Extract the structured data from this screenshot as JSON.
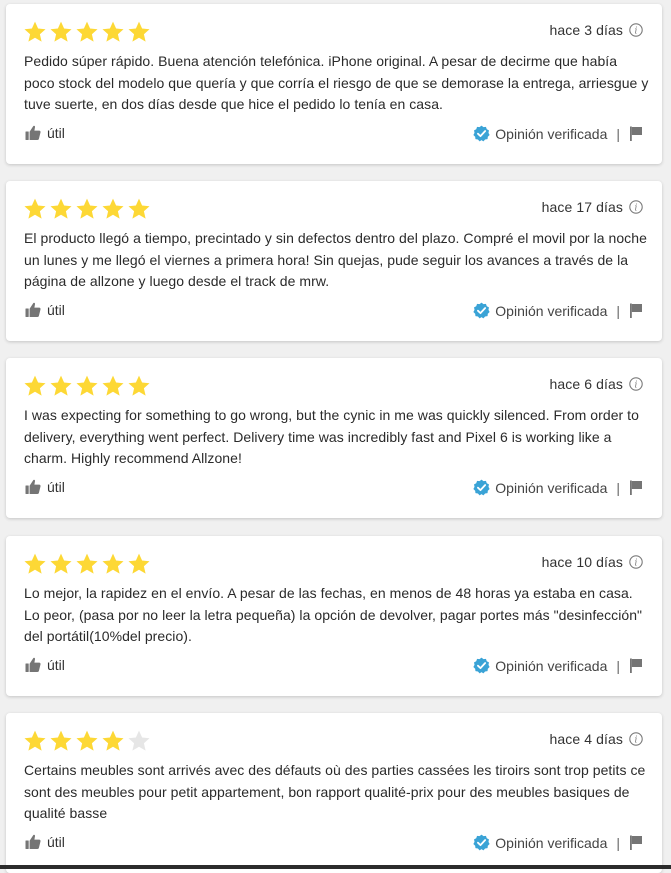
{
  "colors": {
    "star_filled": "#fdd835",
    "star_empty": "#e6e6e6",
    "verified_badge": "#3aa3d6",
    "icon_gray": "#757575"
  },
  "reviews": [
    {
      "rating": 5,
      "date": "hace 3 días",
      "text": "Pedido súper rápido. Buena atención telefónica. iPhone original. A pesar de decirme que había poco stock del modelo que quería y que corría el riesgo de que se demorase la entrega, arriesgue y tuve suerte, en dos días desde que hice el pedido lo tenía en casa.",
      "useful_label": "útil",
      "verified_label": "Opinión verificada",
      "separator": "|"
    },
    {
      "rating": 5,
      "date": "hace 17 días",
      "text": "El producto llegó a tiempo, precintado y sin defectos dentro del plazo. Compré el movil por la noche un lunes y me llegó el viernes a primera hora! Sin quejas, pude seguir los avances a través de la página de allzone y luego desde el track de mrw.",
      "useful_label": "útil",
      "verified_label": "Opinión verificada",
      "separator": "|"
    },
    {
      "rating": 5,
      "date": "hace 6 días",
      "text": "I was expecting for something to go wrong, but the cynic in me was quickly silenced. From order to delivery, everything went perfect. Delivery time was incredibly fast and Pixel 6 is working like a charm. Highly recommend Allzone!",
      "useful_label": "útil",
      "verified_label": "Opinión verificada",
      "separator": "|"
    },
    {
      "rating": 5,
      "date": "hace 10 días",
      "text": "Lo mejor, la rapidez en el envío. A pesar de las fechas, en menos de 48 horas ya estaba en casa. Lo peor, (pasa por no leer la letra pequeña) la opción de devolver, pagar portes más \"desinfección\" del portátil(10%del precio).",
      "useful_label": "útil",
      "verified_label": "Opinión verificada",
      "separator": "|"
    },
    {
      "rating": 4,
      "date": "hace 4 días",
      "text": "Certains meubles sont arrivés avec des défauts où des parties cassées les tiroirs sont trop petits ce sont des meubles pour petit appartement, bon rapport qualité-prix pour des meubles basiques de qualité basse",
      "useful_label": "útil",
      "verified_label": "Opinión verificada",
      "separator": "|"
    }
  ]
}
